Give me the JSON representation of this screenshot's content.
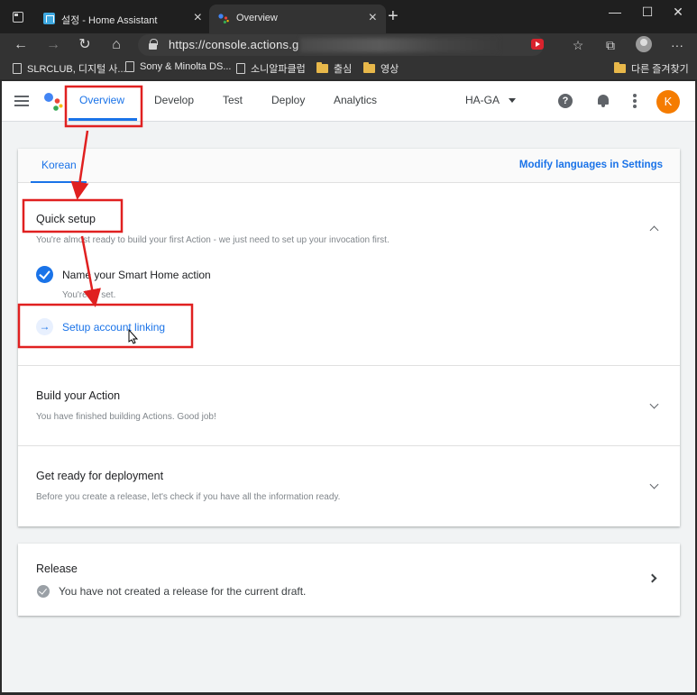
{
  "browser": {
    "tabs": [
      {
        "label": "설정 - Home Assistant",
        "active": false
      },
      {
        "label": "Overview",
        "active": true
      }
    ],
    "new_tab": "+",
    "window_controls": {
      "minimize": "—",
      "maximize": "☐",
      "close": "✕"
    },
    "address": "https://console.actions.g",
    "nav": {
      "back": "←",
      "forward": "→",
      "reload": "↻",
      "home": "⌂"
    },
    "toolbar": {
      "favorites": "☆",
      "collections": "⧉",
      "more": "···"
    },
    "bookmarks": [
      {
        "label": "SLRCLUB, 디지털 사...",
        "icon": "page-icon"
      },
      {
        "label": "Sony & Minolta DS...",
        "icon": "page-icon"
      },
      {
        "label": "소니알파클럽",
        "icon": "page-icon"
      },
      {
        "label": "출심",
        "icon": "folder-icon"
      },
      {
        "label": "영상",
        "icon": "folder-icon"
      },
      {
        "label": "다른 즐겨찾기",
        "icon": "folder-icon"
      }
    ]
  },
  "app": {
    "nav_tabs": [
      "Overview",
      "Develop",
      "Test",
      "Deploy",
      "Analytics"
    ],
    "project": "HA-GA",
    "help": "?",
    "avatar_letter": "K",
    "accent_color": "#1a73e8",
    "avatar_color": "#f57c00"
  },
  "language_bar": {
    "language": "Korean",
    "modify_link": "Modify languages in Settings"
  },
  "quick_setup": {
    "title": "Quick setup",
    "subtitle": "You're almost ready to build your first Action - we just need to set up your invocation first.",
    "step1": {
      "label": "Name your Smart Home action",
      "status": "You're all set."
    },
    "step2": {
      "label": "Setup account linking",
      "icon": "→"
    }
  },
  "build": {
    "title": "Build your Action",
    "subtitle": "You have finished building Actions. Good job!"
  },
  "deploy": {
    "title": "Get ready for deployment",
    "subtitle": "Before you create a release, let's check if you have all the information ready."
  },
  "release": {
    "title": "Release",
    "status": "You have not created a release for the current draft."
  },
  "annotation_color": "#e02020"
}
